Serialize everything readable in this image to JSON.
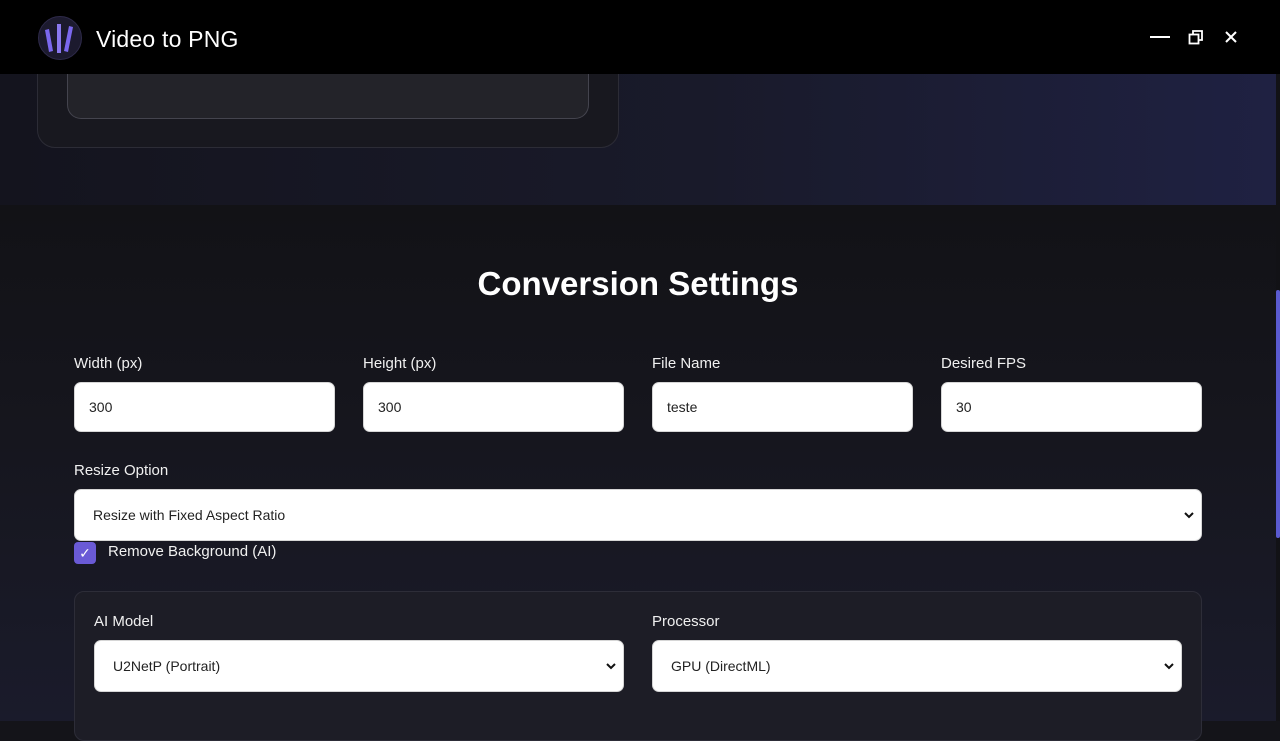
{
  "window": {
    "title": "Video to PNG",
    "controls": {
      "minimize": "—",
      "close": "✕"
    }
  },
  "settings": {
    "heading": "Conversion Settings",
    "width": {
      "label": "Width (px)",
      "value": "300"
    },
    "height": {
      "label": "Height (px)",
      "value": "300"
    },
    "file_name": {
      "label": "File Name",
      "value": "teste"
    },
    "fps": {
      "label": "Desired FPS",
      "value": "30"
    },
    "resize": {
      "label": "Resize Option",
      "selected": "Resize with Fixed Aspect Ratio"
    },
    "remove_background": {
      "label": "Remove Background (AI)",
      "checked": true,
      "check_glyph": "✓"
    },
    "ai_model": {
      "label": "AI Model",
      "selected": "U2NetP (Portrait)"
    },
    "processor": {
      "label": "Processor",
      "selected": "GPU (DirectML)"
    }
  },
  "colors": {
    "accent": "#6a5ad6",
    "logo_bars": "#7b68ee",
    "titlebar": "#000000",
    "background": "#141419"
  }
}
